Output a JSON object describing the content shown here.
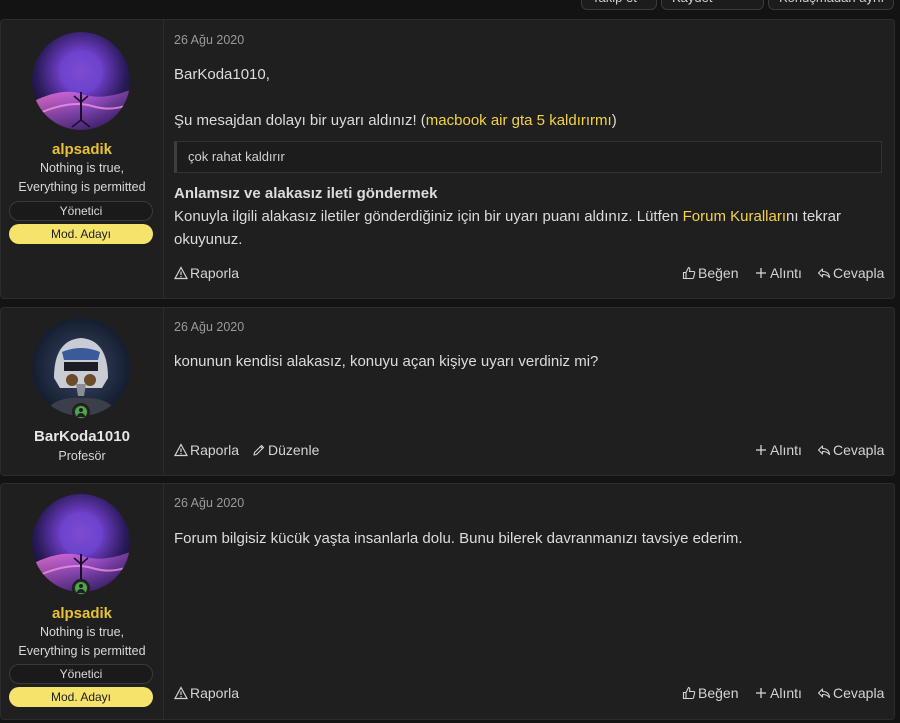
{
  "topbar": {
    "buttons": [
      "Takip et",
      "Kaydet",
      "Konuşmadan ayrıl"
    ]
  },
  "posts": [
    {
      "date": "26 Ağu 2020",
      "user": {
        "name": "alpsadik",
        "title_line1": "Nothing is true,",
        "title_line2": "Everything is permitted",
        "role": "Yönetici",
        "badge": "Mod. Adayı",
        "online": false
      },
      "greeting": "BarKoda1010,",
      "warning_prefix": "Şu mesajdan dolayı bir uyarı aldınız! (",
      "warning_link": "macbook air gta 5 kaldırırmı",
      "warning_suffix": ")",
      "quote": "çok rahat kaldırır",
      "reason_title": "Anlamsız ve alakasız ileti göndermek",
      "reason_text_1": "Konuyla ilgili alakasız iletiler gönderdiğiniz için bir uyarı puanı aldınız. Lütfen ",
      "reason_link": "Forum Kuralları",
      "reason_text_2": "nı tekrar okuyunuz.",
      "actions": {
        "report": "Raporla",
        "like": "Beğen",
        "quote": "Alıntı",
        "reply": "Cevapla"
      }
    },
    {
      "date": "26 Ağu 2020",
      "user": {
        "name": "BarKoda1010",
        "title_line1": "Profesör",
        "online": true
      },
      "body": "konunun kendisi alakasız, konuyu açan kişiye uyarı verdiniz mi?",
      "actions": {
        "report": "Raporla",
        "edit": "Düzenle",
        "quote": "Alıntı",
        "reply": "Cevapla"
      }
    },
    {
      "date": "26 Ağu 2020",
      "user": {
        "name": "alpsadik",
        "title_line1": "Nothing is true,",
        "title_line2": "Everything is permitted",
        "role": "Yönetici",
        "badge": "Mod. Adayı",
        "online": true
      },
      "body": "Forum bilgisiz kücük yaşta insanlarla dolu. Bunu bilerek davranmanızı tavsiye ederim.",
      "actions": {
        "report": "Raporla",
        "like": "Beğen",
        "quote": "Alıntı",
        "reply": "Cevapla"
      }
    }
  ],
  "colors": {
    "accent": "#f3d34a",
    "username": "#e8c234",
    "badge": "#f5e36b",
    "online": "#4ca64c"
  },
  "icons": [
    "warning-icon",
    "thumbs-up-icon",
    "plus-icon",
    "reply-icon",
    "pencil-icon",
    "online-user-icon"
  ]
}
